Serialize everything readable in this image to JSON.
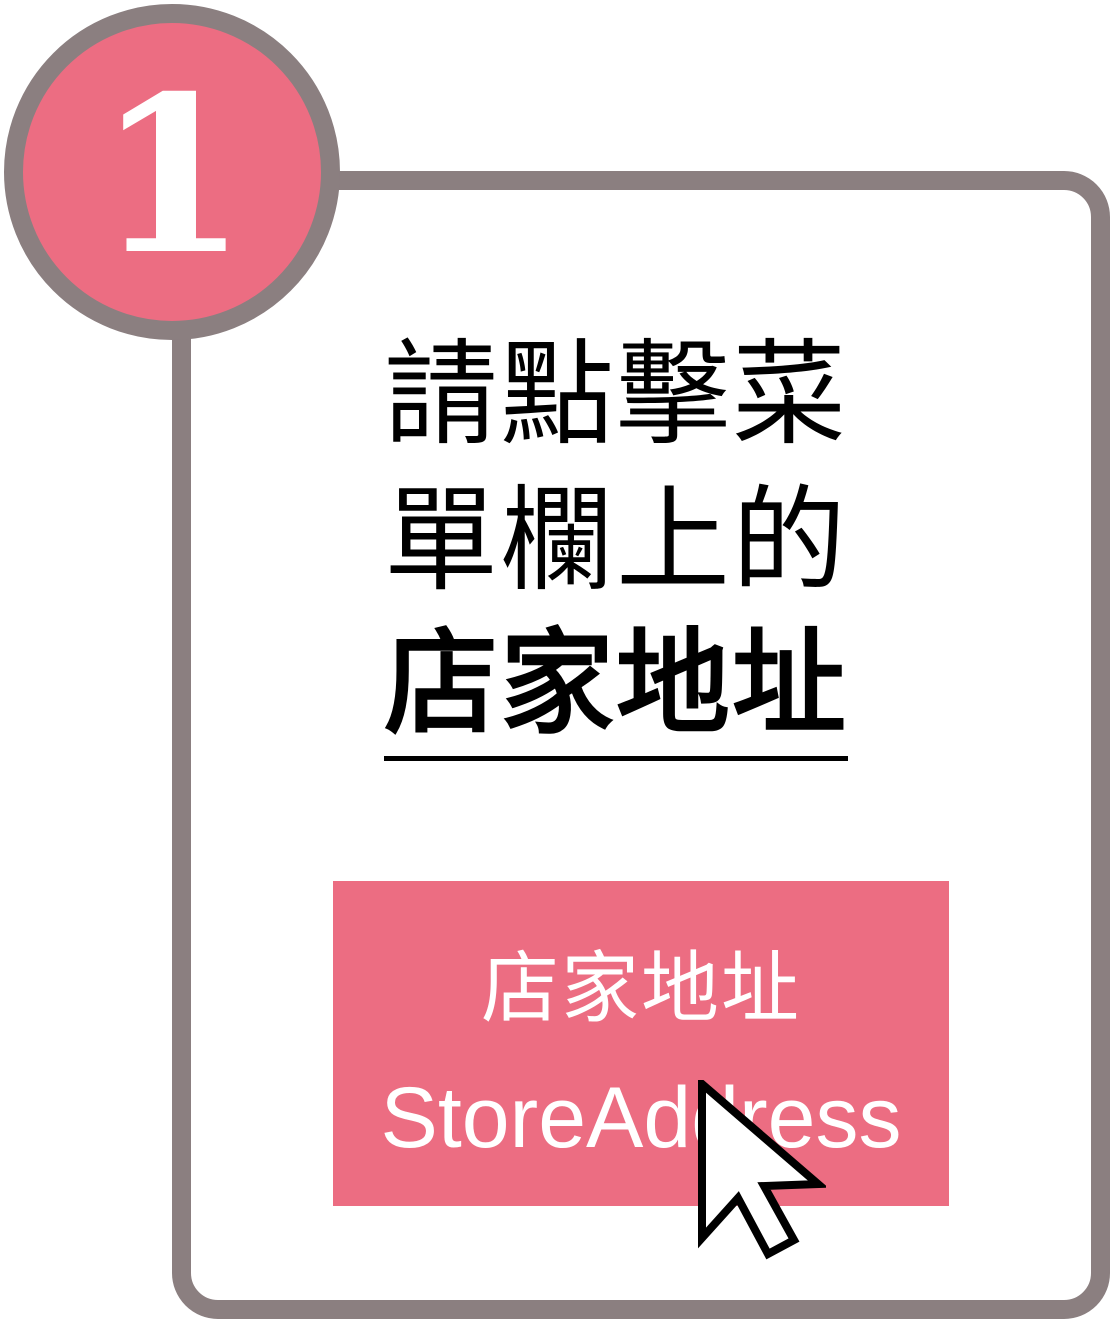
{
  "step": {
    "number": "1"
  },
  "instruction": {
    "line1": "請點擊菜",
    "line2": "單欄上的",
    "emphasis": "店家地址"
  },
  "menu_button": {
    "label_zh": "店家地址",
    "label_en": "StoreAddress"
  },
  "icons": {
    "cursor": "mouse-pointer-icon"
  },
  "colors": {
    "accent_pink": "#ec6d82",
    "frame_gray": "#8b7f80",
    "text_black": "#000000",
    "text_white": "#ffffff"
  }
}
